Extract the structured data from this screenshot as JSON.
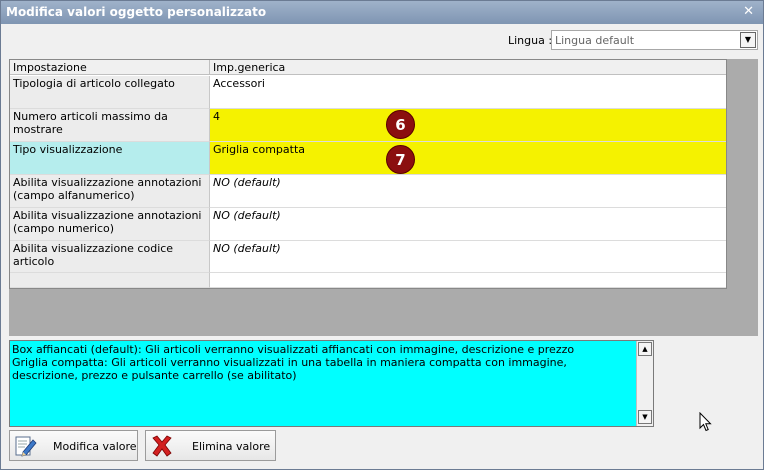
{
  "window": {
    "title": "Modifica valori oggetto personalizzato",
    "close_glyph": "✕"
  },
  "language": {
    "label": "Lingua :",
    "value": "Lingua default",
    "dropdown_icon": "chevron-down-icon"
  },
  "grid": {
    "headers": [
      "Impostazione",
      "Imp.generica"
    ],
    "rows": [
      {
        "key": "Tipologia di articolo collegato",
        "value": "Accessori"
      },
      {
        "key": "Numero articoli massimo da mostrare",
        "value": "4",
        "badge": "6"
      },
      {
        "key": "Tipo visualizzazione",
        "value": "Griglia compatta",
        "badge": "7"
      },
      {
        "key": "Abilita visualizzazione annotazioni (campo alfanumerico)",
        "value": "NO (default)"
      },
      {
        "key": "Abilita visualizzazione annotazioni (campo numerico)",
        "value": "NO (default)"
      },
      {
        "key": "Abilita visualizzazione codice articolo",
        "value": "NO (default)"
      },
      {
        "key": "",
        "value": ""
      }
    ]
  },
  "description": {
    "text": "Box affiancati (default): Gli articoli verranno visualizzati affiancati con immagine, descrizione e prezzo\nGriglia compatta: Gli articoli verranno visualizzati in una tabella in maniera compatta con immagine, descrizione, prezzo e pulsante carrello (se abilitato)"
  },
  "buttons": {
    "edit_label": "Modifica valore",
    "delete_label": "Elimina valore"
  },
  "colors": {
    "highlight_yellow": "#f5f200",
    "selected_key": "#b5eded",
    "description_bg": "#00ffff",
    "badge": "#8b0f0f"
  }
}
